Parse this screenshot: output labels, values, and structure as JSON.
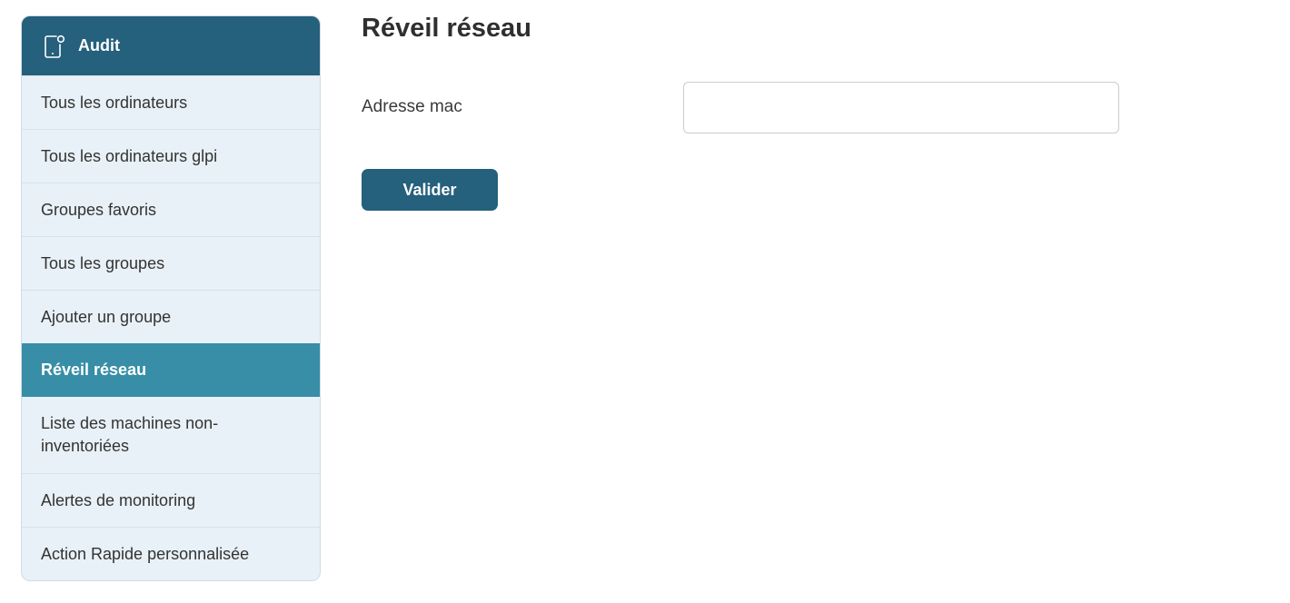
{
  "sidebar": {
    "header": {
      "title": "Audit",
      "icon": "mobile-device-icon"
    },
    "items": [
      {
        "label": "Tous les ordinateurs"
      },
      {
        "label": "Tous les ordinateurs glpi"
      },
      {
        "label": "Groupes favoris"
      },
      {
        "label": "Tous les groupes"
      },
      {
        "label": "Ajouter un groupe"
      },
      {
        "label": "Réveil réseau",
        "active": true
      },
      {
        "label": "Liste des machines non-inventoriées"
      },
      {
        "label": "Alertes de monitoring"
      },
      {
        "label": "Action Rapide personnalisée"
      }
    ]
  },
  "main": {
    "title": "Réveil réseau",
    "form": {
      "mac_label": "Adresse mac",
      "mac_value": "",
      "mac_placeholder": "",
      "submit_label": "Valider"
    }
  },
  "colors": {
    "primary": "#25607c",
    "active_item": "#378ea6",
    "sidebar_bg": "#e8f1f7"
  }
}
